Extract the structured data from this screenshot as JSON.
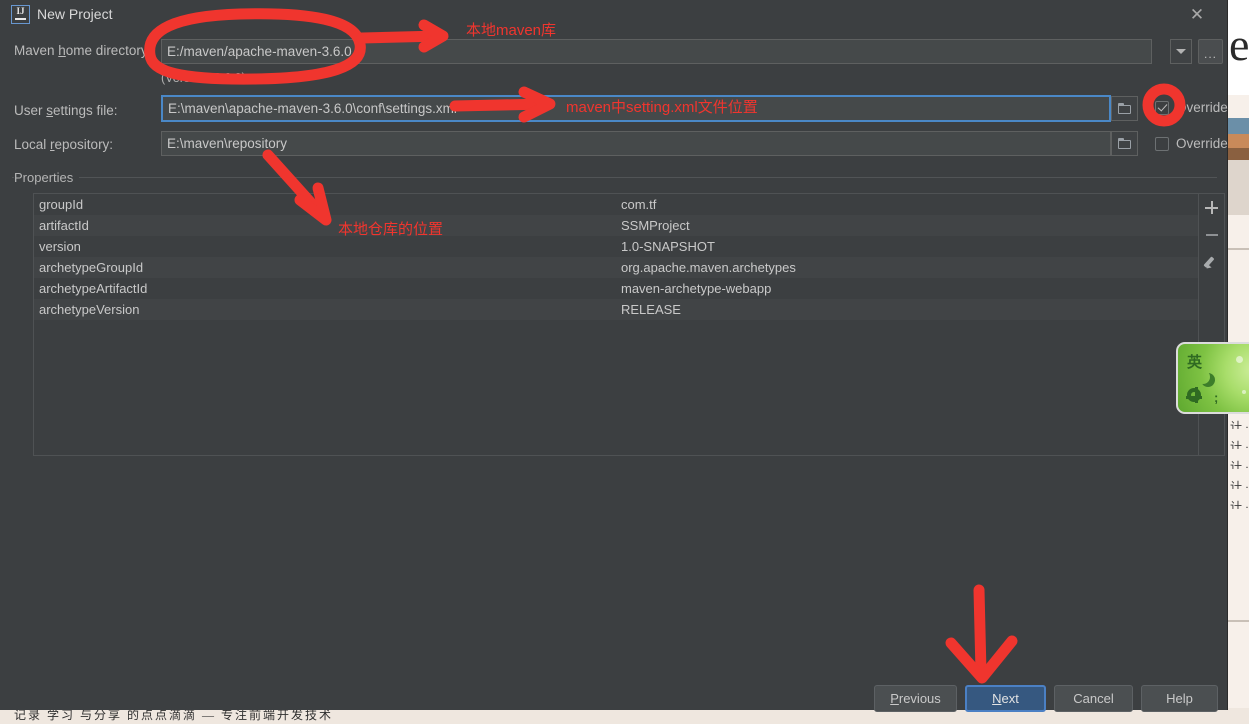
{
  "window": {
    "title": "New Project",
    "app_icon": "intellij-idea-icon",
    "close_icon": "close-icon"
  },
  "form": {
    "maven_home": {
      "label": "Maven home directory:",
      "label_mnemonic": "h",
      "value": "E:/maven/apache-maven-3.6.0",
      "dropdown_icon": "chevron-down-icon",
      "browse_label": "...",
      "version_note": "(Version: 3.6.0)"
    },
    "user_settings": {
      "label": "User settings file:",
      "label_mnemonic": "s",
      "value": "E:\\maven\\apache-maven-3.6.0\\conf\\settings.xml",
      "placeholder": "",
      "folder_icon": "folder-icon",
      "override_label": "Override",
      "override_checked": true
    },
    "local_repository": {
      "label": "Local repository:",
      "label_mnemonic": "r",
      "value": "E:\\maven\\repository",
      "placeholder": "",
      "folder_icon": "folder-icon",
      "override_label": "Override",
      "override_checked": false
    }
  },
  "properties": {
    "group_label": "Properties",
    "rows": [
      {
        "key": "groupId",
        "value": "com.tf"
      },
      {
        "key": "artifactId",
        "value": "SSMProject"
      },
      {
        "key": "version",
        "value": "1.0-SNAPSHOT"
      },
      {
        "key": "archetypeGroupId",
        "value": "org.apache.maven.archetypes"
      },
      {
        "key": "archetypeArtifactId",
        "value": "maven-archetype-webapp"
      },
      {
        "key": "archetypeVersion",
        "value": "RELEASE"
      }
    ],
    "toolbar": {
      "add_icon": "plus-icon",
      "remove_icon": "minus-icon",
      "edit_icon": "pencil-icon"
    }
  },
  "buttons": {
    "previous": "Previous",
    "previous_mnemonic": "P",
    "next": "Next",
    "next_mnemonic": "N",
    "cancel": "Cancel",
    "help": "Help"
  },
  "annotations": {
    "accent_color": "#f0352e",
    "maven_home_note": "本地maven库",
    "settings_note": "maven中setting.xml文件位置",
    "repository_note": "本地仓库的位置"
  },
  "ime_widget": {
    "mode_label": "英",
    "moon_icon": "moon-icon",
    "gear_icon": "gear-icon",
    "semicolon_label": ";"
  },
  "background": {
    "letter": "e",
    "text_lines": [
      "计 ·",
      "计 ·",
      "计 ·",
      "计 ·",
      "计 ·"
    ],
    "bottom_strip": "记录  学习  与分享 的点点滴滴 — 专注前端开发技术"
  }
}
